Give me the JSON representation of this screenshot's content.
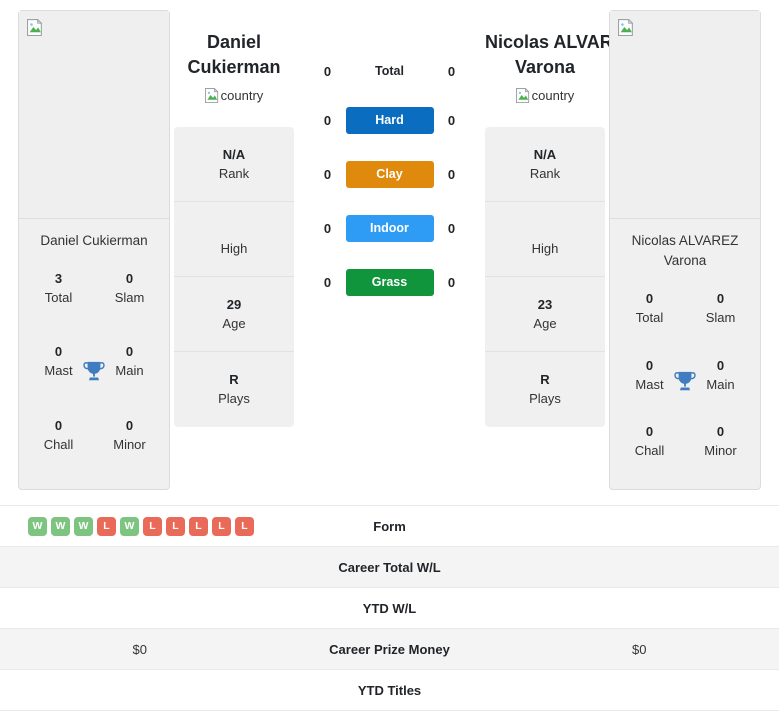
{
  "players": {
    "left": {
      "name": "Daniel Cukierman",
      "name_line1": "Daniel",
      "name_line2": "Cukierman",
      "photo_alt": "",
      "flag_alt": "country",
      "rank": "N/A",
      "rank_label": "Rank",
      "high": "",
      "high_label": "High",
      "age": "29",
      "age_label": "Age",
      "plays": "R",
      "plays_label": "Plays",
      "titles": [
        {
          "value": "3",
          "label": "Total"
        },
        {
          "value": "0",
          "label": "Slam"
        },
        {
          "value": "0",
          "label": "Mast"
        },
        {
          "value": "0",
          "label": "Main"
        },
        {
          "value": "0",
          "label": "Chall"
        },
        {
          "value": "0",
          "label": "Minor"
        }
      ]
    },
    "right": {
      "name": "Nicolas ALVAREZ Varona",
      "name_line1": "Nicolas ALVAREZ",
      "name_line2": "Varona",
      "photo_alt": "",
      "flag_alt": "country",
      "rank": "N/A",
      "rank_label": "Rank",
      "high": "",
      "high_label": "High",
      "age": "23",
      "age_label": "Age",
      "plays": "R",
      "plays_label": "Plays",
      "titles": [
        {
          "value": "0",
          "label": "Total"
        },
        {
          "value": "0",
          "label": "Slam"
        },
        {
          "value": "0",
          "label": "Mast"
        },
        {
          "value": "0",
          "label": "Main"
        },
        {
          "value": "0",
          "label": "Chall"
        },
        {
          "value": "0",
          "label": "Minor"
        }
      ]
    }
  },
  "head_to_head": {
    "rows": [
      {
        "label": "Total",
        "left": "0",
        "right": "0",
        "badge": false,
        "color": ""
      },
      {
        "label": "Hard",
        "left": "0",
        "right": "0",
        "badge": true,
        "color": "#0b6dc0"
      },
      {
        "label": "Clay",
        "left": "0",
        "right": "0",
        "badge": true,
        "color": "#df8a0c"
      },
      {
        "label": "Indoor",
        "left": "0",
        "right": "0",
        "badge": true,
        "color": "#2e9cf5"
      },
      {
        "label": "Grass",
        "left": "0",
        "right": "0",
        "badge": true,
        "color": "#10943c"
      }
    ]
  },
  "comparison_table": {
    "rows": [
      {
        "label": "Form",
        "left": "",
        "right": "",
        "type": "form"
      },
      {
        "label": "Career Total W/L",
        "left": "",
        "right": "",
        "type": "text"
      },
      {
        "label": "YTD W/L",
        "left": "",
        "right": "",
        "type": "text"
      },
      {
        "label": "Career Prize Money",
        "left": "$0",
        "right": "$0",
        "type": "text"
      },
      {
        "label": "YTD Titles",
        "left": "",
        "right": "",
        "type": "text"
      }
    ],
    "form_left": [
      "W",
      "W",
      "W",
      "L",
      "W",
      "L",
      "L",
      "L",
      "L",
      "L"
    ],
    "form_right": []
  },
  "colors": {
    "win": "#7cc47f",
    "loss": "#ea6a5a",
    "trophy": "#3f7cc0",
    "card_bg": "#f0f0f0",
    "row_alt": "#f4f4f4"
  }
}
